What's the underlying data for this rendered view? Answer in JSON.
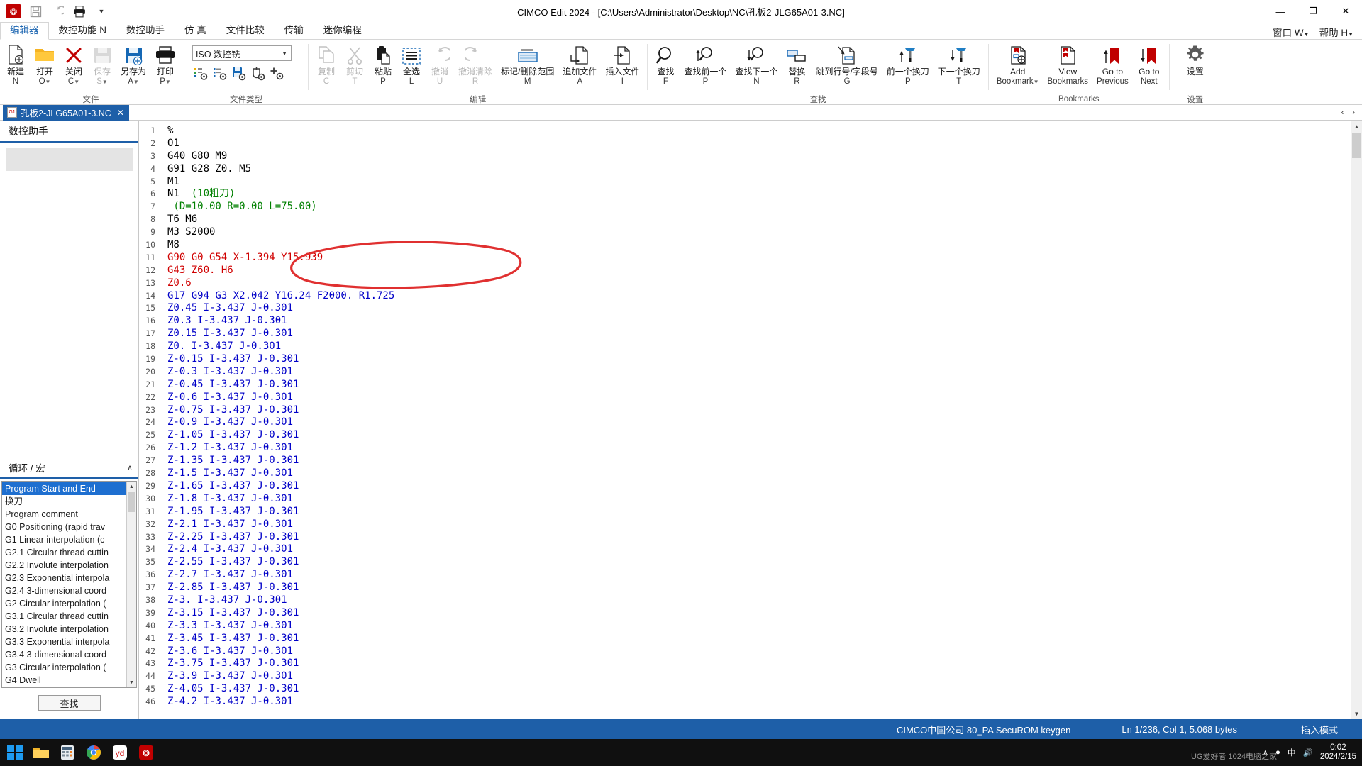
{
  "titlebar": {
    "app_icon": "cimco-logo-icon",
    "quick_access": [
      {
        "name": "save-icon",
        "glyph": "💾"
      },
      {
        "name": "undo-icon",
        "glyph": "↺"
      },
      {
        "name": "print-icon",
        "glyph": "🖨"
      },
      {
        "name": "customize-qat-icon",
        "glyph": "▾"
      }
    ],
    "title": "CIMCO Edit 2024 - [C:\\Users\\Administrator\\Desktop\\NC\\孔板2-JLG65A01-3.NC]",
    "minimize": "—",
    "maximize": "❐",
    "close": "✕"
  },
  "tabs": {
    "items": [
      {
        "label": "编辑器",
        "active": true
      },
      {
        "label": "数控功能 N",
        "active": false
      },
      {
        "label": "数控助手",
        "active": false
      },
      {
        "label": "仿 真",
        "active": false
      },
      {
        "label": "文件比较",
        "active": false
      },
      {
        "label": "传输",
        "active": false
      },
      {
        "label": "迷你编程",
        "active": false
      }
    ],
    "right": [
      {
        "label": "窗口 W",
        "caret": "▾"
      },
      {
        "label": "帮助 H",
        "caret": "▾"
      }
    ]
  },
  "ribbon": {
    "groups": [
      {
        "name": "file",
        "label": "文件",
        "has_launcher": true,
        "buttons": [
          {
            "icon": "new-file-icon",
            "label": "新建",
            "key": "N",
            "caret": "",
            "disabled": false
          },
          {
            "icon": "open-folder-icon",
            "label": "打开",
            "key": "O",
            "caret": "▾",
            "disabled": false
          },
          {
            "icon": "close-x-icon",
            "label": "关闭",
            "key": "C",
            "caret": "▾",
            "disabled": false
          },
          {
            "icon": "save-disk-icon",
            "label": "保存",
            "key": "S",
            "caret": "▾",
            "disabled": true
          },
          {
            "icon": "save-as-icon",
            "label": "另存为",
            "key": "A",
            "caret": "▾",
            "disabled": false
          },
          {
            "icon": "printer-icon",
            "label": "打印",
            "key": "P",
            "caret": "▾",
            "disabled": false
          }
        ]
      },
      {
        "name": "filetype",
        "label": "文件类型",
        "has_launcher": true,
        "select_value": "ISO 数控铣",
        "select_arrow": "▼",
        "mini_icons": [
          "filetype-setup-icon",
          "filetype-list-icon",
          "filetype-save-icon",
          "filetype-machine-icon",
          "filetype-add-icon"
        ]
      },
      {
        "name": "edit",
        "label": "编辑",
        "has_launcher": false,
        "buttons": [
          {
            "icon": "copy-icon",
            "label": "复制",
            "key": "C",
            "caret": "",
            "disabled": true
          },
          {
            "icon": "cut-scissors-icon",
            "label": "剪切",
            "key": "T",
            "caret": "",
            "disabled": true
          },
          {
            "icon": "paste-icon",
            "label": "粘贴",
            "key": "P",
            "caret": "",
            "disabled": false
          },
          {
            "icon": "select-all-icon",
            "label": "全选",
            "key": "L",
            "caret": "",
            "disabled": false
          },
          {
            "icon": "undo-icon",
            "label": "撤消",
            "key": "U",
            "caret": "",
            "disabled": true
          },
          {
            "icon": "redo-icon",
            "label": "撤消清除",
            "key": "R",
            "caret": "",
            "disabled": true
          },
          {
            "icon": "mark-delete-range-icon",
            "label": "标记/删除范围",
            "key": "M",
            "caret": "",
            "disabled": false
          },
          {
            "icon": "append-file-icon",
            "label": "追加文件",
            "key": "A",
            "caret": "",
            "disabled": false
          },
          {
            "icon": "insert-file-icon",
            "label": "插入文件",
            "key": "I",
            "caret": "",
            "disabled": false
          }
        ]
      },
      {
        "name": "search",
        "label": "查找",
        "has_launcher": false,
        "buttons": [
          {
            "icon": "search-icon",
            "label": "查找",
            "key": "F",
            "caret": "",
            "disabled": false
          },
          {
            "icon": "search-prev-icon",
            "label": "查找前一个",
            "key": "P",
            "caret": "",
            "disabled": false
          },
          {
            "icon": "search-next-icon",
            "label": "查找下一个",
            "key": "N",
            "caret": "",
            "disabled": false
          },
          {
            "icon": "replace-icon",
            "label": "替换",
            "key": "R",
            "caret": "",
            "disabled": false
          },
          {
            "icon": "goto-line-icon",
            "label": "跳到行号/字段号",
            "key": "G",
            "caret": "",
            "disabled": false
          },
          {
            "icon": "prev-toolchange-icon",
            "label": "前一个换刀",
            "key": "P",
            "caret": "",
            "disabled": false
          },
          {
            "icon": "next-toolchange-icon",
            "label": "下一个换刀",
            "key": "T",
            "caret": "",
            "disabled": false
          }
        ]
      },
      {
        "name": "bookmarks",
        "label": "Bookmarks",
        "has_launcher": false,
        "buttons": [
          {
            "icon": "add-bookmark-icon",
            "label": "Add",
            "key": "Bookmark",
            "caret": "▾",
            "disabled": false
          },
          {
            "icon": "view-bookmarks-icon",
            "label": "View",
            "key": "Bookmarks",
            "caret": "",
            "disabled": false
          },
          {
            "icon": "goto-previous-bookmark-icon",
            "label": "Go to",
            "key": "Previous",
            "caret": "",
            "disabled": false
          },
          {
            "icon": "goto-next-bookmark-icon",
            "label": "Go to",
            "key": "Next",
            "caret": "",
            "disabled": false
          }
        ]
      },
      {
        "name": "settings",
        "label": "设置",
        "has_launcher": false,
        "buttons": [
          {
            "icon": "gear-icon",
            "label": "设置",
            "key": "",
            "caret": "",
            "disabled": false
          }
        ]
      }
    ]
  },
  "doctabs": {
    "tabs": [
      {
        "icon": "nc-file-icon",
        "label": "孔板2-JLG65A01-3.NC",
        "close": "✕"
      }
    ],
    "nav_prev": "‹",
    "nav_next": "›"
  },
  "left_panel": {
    "title": "数控助手",
    "section_label": "循环 / 宏",
    "section_chevron": "∧",
    "list_items": [
      "Program Start and End",
      "换刀",
      "Program comment",
      "G0 Positioning (rapid trav",
      "G1 Linear interpolation (c",
      "G2.1 Circular thread cuttin",
      "G2.2 Involute interpolation",
      "G2.3 Exponential interpola",
      "G2.4 3-dimensional coord",
      "G2 Circular interpolation (",
      "G3.1 Circular thread cuttin",
      "G3.2 Involute interpolation",
      "G3.3 Exponential interpola",
      "G3.4 3-dimensional coord",
      "G3 Circular interpolation (",
      "G4 Dwell"
    ],
    "selected_index": 0,
    "find_button": "查找",
    "scroll_up": "▲",
    "scroll_down": "▼"
  },
  "editor": {
    "first_line_number": 1,
    "lines": [
      {
        "n": 1,
        "text": "%",
        "color": "black"
      },
      {
        "n": 2,
        "text": "O1",
        "color": "black"
      },
      {
        "n": 3,
        "text": "G40 G80 M9",
        "color": "black"
      },
      {
        "n": 4,
        "text": "G91 G28 Z0. M5",
        "color": "black"
      },
      {
        "n": 5,
        "text": "M1",
        "color": "black"
      },
      {
        "n": 6,
        "text": "N1  (10粗刀)",
        "color": "mixed-n-comment"
      },
      {
        "n": 7,
        "text": " (D=10.00 R=0.00 L=75.00)",
        "color": "green"
      },
      {
        "n": 8,
        "text": "T6 M6",
        "color": "black"
      },
      {
        "n": 9,
        "text": "M3 S2000",
        "color": "black"
      },
      {
        "n": 10,
        "text": "M8",
        "color": "black"
      },
      {
        "n": 11,
        "text": "G90 G0 G54 X-1.394 Y15.939",
        "color": "red"
      },
      {
        "n": 12,
        "text": "G43 Z60. H6",
        "color": "red"
      },
      {
        "n": 13,
        "text": "Z0.6",
        "color": "red"
      },
      {
        "n": 14,
        "text": "G17 G94 G3 X2.042 Y16.24 F2000. R1.725",
        "color": "blue"
      },
      {
        "n": 15,
        "text": "Z0.45 I-3.437 J-0.301",
        "color": "blue"
      },
      {
        "n": 16,
        "text": "Z0.3 I-3.437 J-0.301",
        "color": "blue"
      },
      {
        "n": 17,
        "text": "Z0.15 I-3.437 J-0.301",
        "color": "blue"
      },
      {
        "n": 18,
        "text": "Z0. I-3.437 J-0.301",
        "color": "blue"
      },
      {
        "n": 19,
        "text": "Z-0.15 I-3.437 J-0.301",
        "color": "blue"
      },
      {
        "n": 20,
        "text": "Z-0.3 I-3.437 J-0.301",
        "color": "blue"
      },
      {
        "n": 21,
        "text": "Z-0.45 I-3.437 J-0.301",
        "color": "blue"
      },
      {
        "n": 22,
        "text": "Z-0.6 I-3.437 J-0.301",
        "color": "blue"
      },
      {
        "n": 23,
        "text": "Z-0.75 I-3.437 J-0.301",
        "color": "blue"
      },
      {
        "n": 24,
        "text": "Z-0.9 I-3.437 J-0.301",
        "color": "blue"
      },
      {
        "n": 25,
        "text": "Z-1.05 I-3.437 J-0.301",
        "color": "blue"
      },
      {
        "n": 26,
        "text": "Z-1.2 I-3.437 J-0.301",
        "color": "blue"
      },
      {
        "n": 27,
        "text": "Z-1.35 I-3.437 J-0.301",
        "color": "blue"
      },
      {
        "n": 28,
        "text": "Z-1.5 I-3.437 J-0.301",
        "color": "blue"
      },
      {
        "n": 29,
        "text": "Z-1.65 I-3.437 J-0.301",
        "color": "blue"
      },
      {
        "n": 30,
        "text": "Z-1.8 I-3.437 J-0.301",
        "color": "blue"
      },
      {
        "n": 31,
        "text": "Z-1.95 I-3.437 J-0.301",
        "color": "blue"
      },
      {
        "n": 32,
        "text": "Z-2.1 I-3.437 J-0.301",
        "color": "blue"
      },
      {
        "n": 33,
        "text": "Z-2.25 I-3.437 J-0.301",
        "color": "blue"
      },
      {
        "n": 34,
        "text": "Z-2.4 I-3.437 J-0.301",
        "color": "blue"
      },
      {
        "n": 35,
        "text": "Z-2.55 I-3.437 J-0.301",
        "color": "blue"
      },
      {
        "n": 36,
        "text": "Z-2.7 I-3.437 J-0.301",
        "color": "blue"
      },
      {
        "n": 37,
        "text": "Z-2.85 I-3.437 J-0.301",
        "color": "blue"
      },
      {
        "n": 38,
        "text": "Z-3. I-3.437 J-0.301",
        "color": "blue"
      },
      {
        "n": 39,
        "text": "Z-3.15 I-3.437 J-0.301",
        "color": "blue"
      },
      {
        "n": 40,
        "text": "Z-3.3 I-3.437 J-0.301",
        "color": "blue"
      },
      {
        "n": 41,
        "text": "Z-3.45 I-3.437 J-0.301",
        "color": "blue"
      },
      {
        "n": 42,
        "text": "Z-3.6 I-3.437 J-0.301",
        "color": "blue"
      },
      {
        "n": 43,
        "text": "Z-3.75 I-3.437 J-0.301",
        "color": "blue"
      },
      {
        "n": 44,
        "text": "Z-3.9 I-3.437 J-0.301",
        "color": "blue"
      },
      {
        "n": 45,
        "text": "Z-4.05 I-3.437 J-0.301",
        "color": "blue"
      },
      {
        "n": 46,
        "text": "Z-4.2 I-3.437 J-0.301",
        "color": "blue"
      }
    ],
    "annotation": {
      "shape": "hand-drawn-ellipse",
      "color": "#e03030",
      "encircles_lines": [
        11,
        12
      ]
    },
    "scroll_up": "▲",
    "scroll_down": "▼"
  },
  "status_bar": {
    "registration": "CIMCO中国公司 80_PA SecuROM keygen",
    "position": "Ln 1/236, Col 1, 5.068 bytes",
    "mode": "插入模式"
  },
  "taskbar": {
    "start": "windows-start-icon",
    "items": [
      {
        "name": "file-explorer-icon"
      },
      {
        "name": "calculator-icon"
      },
      {
        "name": "chrome-icon"
      },
      {
        "name": "youdao-icon"
      },
      {
        "name": "cimco-edit-icon"
      }
    ],
    "tray": {
      "expand": "∧",
      "network": "●",
      "ime": "中",
      "volume": "🔊",
      "time": "0:02",
      "date": "2024/2/15"
    },
    "watermark": "UG爱好者 1024电脑之家"
  }
}
